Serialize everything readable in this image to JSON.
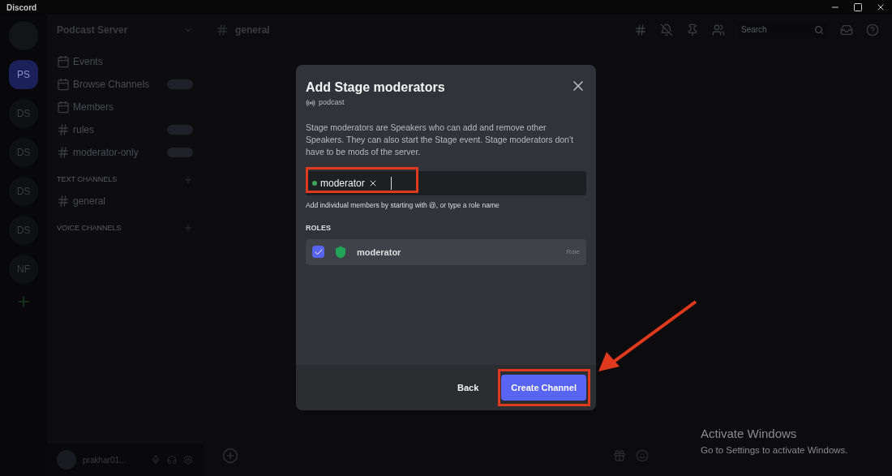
{
  "window": {
    "title": "Discord"
  },
  "servers": [
    {
      "label": "PS",
      "selected": true
    },
    {
      "label": "DS",
      "selected": false
    },
    {
      "label": "DS",
      "selected": false
    },
    {
      "label": "DS",
      "selected": false
    },
    {
      "label": "DS",
      "selected": false
    },
    {
      "label": "NF",
      "selected": false
    }
  ],
  "sidebar": {
    "server_name": "Podcast Server",
    "items": [
      {
        "kind": "nav",
        "label": "Events",
        "badge": false
      },
      {
        "kind": "nav",
        "label": "Browse Channels",
        "badge": true
      },
      {
        "kind": "nav",
        "label": "Members",
        "badge": false
      },
      {
        "kind": "channel",
        "label": "rules",
        "badge": true
      },
      {
        "kind": "channel",
        "label": "moderator-only",
        "badge": true
      },
      {
        "kind": "category",
        "label": "TEXT CHANNELS",
        "badge": false
      },
      {
        "kind": "channel",
        "label": "general",
        "badge": false
      },
      {
        "kind": "category",
        "label": "VOICE CHANNELS",
        "badge": false
      }
    ],
    "user": {
      "name": "prakhar01..."
    }
  },
  "header": {
    "channel": "general",
    "search_placeholder": "Search"
  },
  "dialog": {
    "title": "Add Stage moderators",
    "channel": "podcast",
    "description": "Stage moderators are Speakers who can add and remove other Speakers. They can also start the Stage event. Stage moderators don't have to be mods of the server.",
    "chips": [
      {
        "label": "moderator",
        "color": "#3ba55c"
      }
    ],
    "hint": "Add individual members by starting with @, or type a role name",
    "section": "ROLES",
    "rows": [
      {
        "name": "moderator",
        "type": "Role",
        "checked": true
      }
    ],
    "buttons": {
      "back": "Back",
      "create": "Create Channel"
    }
  },
  "watermark_notice": {
    "title": "Activate Windows",
    "subtitle": "Go to Settings to activate Windows."
  }
}
